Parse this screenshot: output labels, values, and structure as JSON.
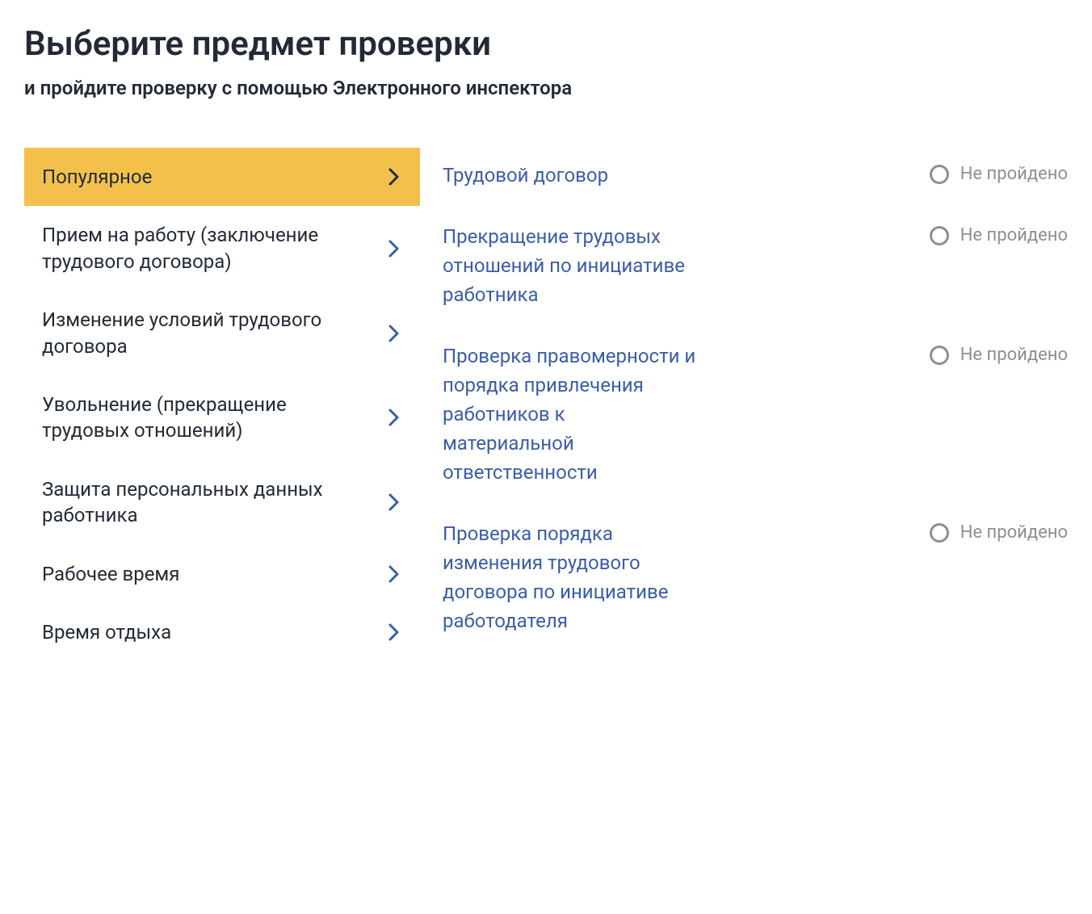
{
  "header": {
    "title": "Выберите предмет проверки",
    "subtitle": "и пройдите проверку с помощью Электронного инспектора"
  },
  "categories": [
    {
      "label": "Популярное",
      "active": true
    },
    {
      "label": "Прием на работу (заключение трудового договора)",
      "active": false
    },
    {
      "label": "Изменение условий трудового договора",
      "active": false
    },
    {
      "label": "Увольнение (прекращение трудовых отношений)",
      "active": false
    },
    {
      "label": "Защита персональных данных работника",
      "active": false
    },
    {
      "label": "Рабочее время",
      "active": false
    },
    {
      "label": "Время отдыха",
      "active": false
    }
  ],
  "topics": [
    {
      "title": "Трудовой договор",
      "status": "Не пройдено"
    },
    {
      "title": "Прекращение трудовых отношений по инициативе работника",
      "status": "Не пройдено"
    },
    {
      "title": "Проверка правомерности и порядка привлечения работников к материальной ответственности",
      "status": "Не пройдено"
    },
    {
      "title": "Проверка порядка изменения трудового договора по инициативе работодателя",
      "status": "Не пройдено"
    }
  ]
}
